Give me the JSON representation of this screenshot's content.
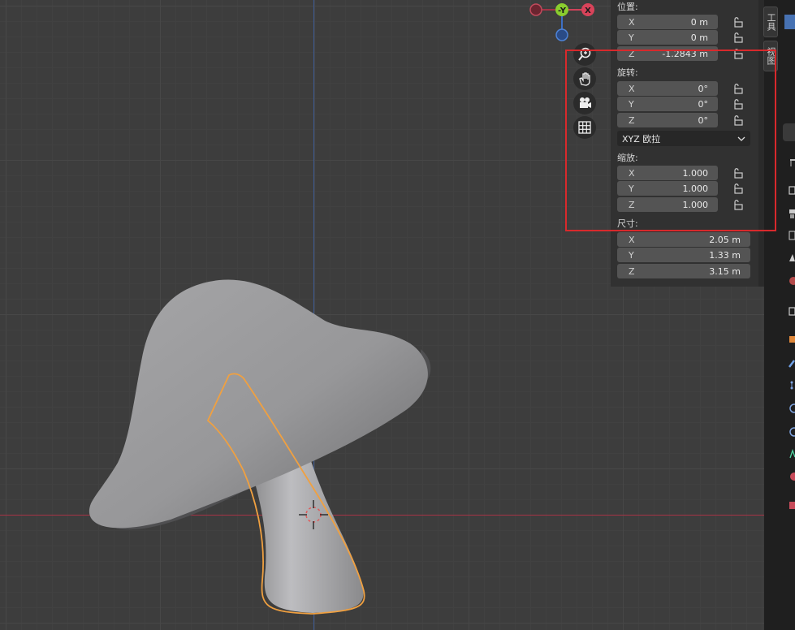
{
  "viewport": {
    "tabs": {
      "tool": "工具",
      "view": "视图"
    },
    "gizmo": {
      "y_label": "-Y",
      "x_label": "X"
    }
  },
  "transform": {
    "location": {
      "label": "位置:",
      "x": {
        "axis": "X",
        "value": "0 m"
      },
      "y": {
        "axis": "Y",
        "value": "0 m"
      },
      "z": {
        "axis": "Z",
        "value": "-1.2843 m"
      }
    },
    "rotation": {
      "label": "旋转:",
      "x": {
        "axis": "X",
        "value": "0°"
      },
      "y": {
        "axis": "Y",
        "value": "0°"
      },
      "z": {
        "axis": "Z",
        "value": "0°"
      },
      "mode": "XYZ 欧拉"
    },
    "scale": {
      "label": "缩放:",
      "x": {
        "axis": "X",
        "value": "1.000"
      },
      "y": {
        "axis": "Y",
        "value": "1.000"
      },
      "z": {
        "axis": "Z",
        "value": "1.000"
      }
    },
    "dimensions": {
      "label": "尺寸:",
      "x": {
        "axis": "X",
        "value": "2.05 m"
      },
      "y": {
        "axis": "Y",
        "value": "1.33 m"
      },
      "z": {
        "axis": "Z",
        "value": "3.15 m"
      }
    }
  },
  "colors": {
    "highlight": "#d8292c",
    "selection_outline": "#f0a040",
    "x_axis": "#a63346",
    "z_axis": "#3d5a92"
  }
}
